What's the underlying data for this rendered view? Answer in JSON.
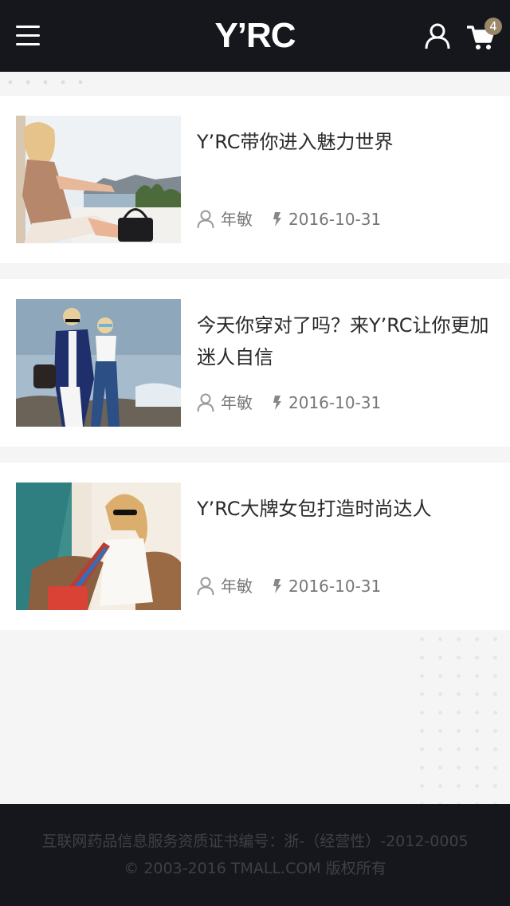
{
  "header": {
    "logo": "Y’RC",
    "cart_count": "4",
    "icons": {
      "menu": "hamburger-menu-icon",
      "user": "user-icon",
      "cart": "shopping-cart-icon"
    }
  },
  "articles": [
    {
      "title": "Y’RC带你进入魅力世界",
      "author": "年敏",
      "date": "2016-10-31",
      "image": "woman-with-handbag-seaside-photo"
    },
    {
      "title": "今天你穿对了吗？来Y’RC让你更加迷人自信",
      "author": "年敏",
      "date": "2016-10-31",
      "image": "couple-on-rocky-beach-photo"
    },
    {
      "title": "Y’RC大牌女包打造时尚达人",
      "author": "年敏",
      "date": "2016-10-31",
      "image": "woman-with-sunglasses-poolside-photo"
    }
  ],
  "footer": {
    "license": "互联网药品信息服务资质证书编号：浙-（经营性）-2012-0005",
    "copyright": "© 2003-2016 TMALL.COM 版权所有"
  },
  "colors": {
    "header_bg": "#15171c",
    "badge": "#9a8668",
    "page_bg": "#f5f5f5"
  }
}
